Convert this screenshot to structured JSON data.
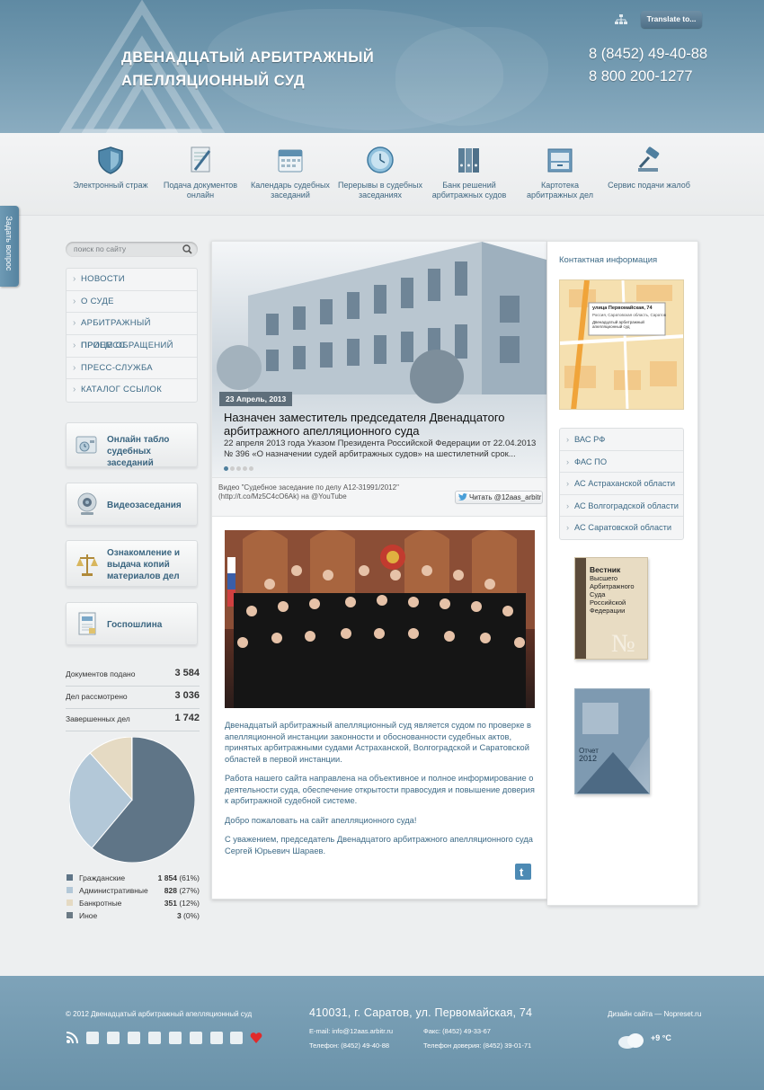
{
  "header": {
    "title_line1": "ДВЕНАДЦАТЫЙ АРБИТРАЖНЫЙ",
    "title_line2": "АПЕЛЛЯЦИОННЫЙ СУД",
    "phone1": "8 (8452) 49-40-88",
    "phone2": "8 800 200-1277",
    "translate_label": "Translate to...",
    "sitemap_icon": "sitemap-icon"
  },
  "quick_icons": [
    {
      "label": "Электронный страж",
      "icon": "shield-icon"
    },
    {
      "label": "Подача документов онлайн",
      "icon": "document-pen-icon"
    },
    {
      "label": "Календарь судебных заседаний",
      "icon": "calendar-icon"
    },
    {
      "label": "Перерывы в судебных заседаниях",
      "icon": "clock-icon"
    },
    {
      "label": "Банк решений арбитражных судов",
      "icon": "binders-icon"
    },
    {
      "label": "Картотека арбитражных дел",
      "icon": "card-index-icon"
    },
    {
      "label": "Сервис подачи жалоб",
      "icon": "gavel-icon"
    }
  ],
  "ask_question": "Задать вопрос",
  "search": {
    "placeholder": "поиск по сайту"
  },
  "menu": [
    "НОВОСТИ",
    "О СУДЕ",
    "АРБИТРАЖНЫЙ ПРОЦЕСС",
    "ПРИЕМ ОБРАЩЕНИЙ",
    "ПРЕСС-СЛУЖБА",
    "КАТАЛОГ ССЫЛОК"
  ],
  "side_buttons": [
    {
      "line1": "Онлайн табло",
      "line2": "судебных заседаний",
      "line3": "",
      "icon": "board-icon"
    },
    {
      "line1": "Видеозаседания",
      "line2": "",
      "line3": "",
      "icon": "webcam-icon"
    },
    {
      "line1": "Ознакомление и",
      "line2": "выдача копий",
      "line3": "материалов дел",
      "icon": "scales-icon"
    },
    {
      "line1": "Госпошлина",
      "line2": "",
      "line3": "",
      "icon": "receipt-icon"
    }
  ],
  "stats": [
    {
      "label": "Документов подано",
      "value": "3 584"
    },
    {
      "label": "Дел рассмотрено",
      "value": "3 036"
    },
    {
      "label": "Завершенных дел",
      "value": "1 742"
    }
  ],
  "chart_data": {
    "type": "pie",
    "categories": [
      "Гражданские",
      "Административные",
      "Банкротные",
      "Иное"
    ],
    "values": [
      1854,
      828,
      351,
      3
    ],
    "percent_labels": [
      "(61%)",
      "(27%)",
      "(12%)",
      "(0%)"
    ],
    "value_labels": [
      "1 854",
      "828",
      "351",
      "3"
    ],
    "colors": [
      "#5f7587",
      "#b3c8d8",
      "#e5dac3",
      "#6b7a85"
    ]
  },
  "slider": {
    "date": "23 Апрель, 2013",
    "headline": "Назначен заместитель председателя Двенадцатого арбитражного апелляционного суда",
    "text": "22 апреля 2013 года Указом Президента Российской Федерации от 22.04.2013 № 396 «О назначении судей арбитражных судов» на шестилетний срок..."
  },
  "tweet": {
    "text": "Видео \"Судебное заседание по делу А12-31991/2012\" (http://t.co/Mz5C4cO6Ak) на @YouTube",
    "button": "Читать @12aas_arbitr"
  },
  "intro": {
    "p1": "Двенадцатый арбитражный апелляционный суд является судом по проверке в апелляционной инстанции законности и обоснованности судебных актов, принятых арбитражными судами Астраханской, Волгоградской и Саратовской областей в первой инстанции.",
    "p2": "Работа нашего сайта направлена на объективное и полное информирование о деятельности суда, обеспечение открытости правосудия и повышение доверия к арбитражной судебной системе.",
    "p3": "Добро пожаловать на сайт апелляционного суда!",
    "p4": "С уважением, председатель Двенадцатого арбитражного апелляционного суда Сергей Юрьевич Шараев."
  },
  "right": {
    "contact_title": "Контактная информация",
    "map_street": "улица Первомайская, 74",
    "map_addr": "Россия, Саратовская область, Саратов",
    "map_org": "Двенадцатый арбитражный апелляционный суд",
    "links": [
      "ВАС РФ",
      "ФАС ПО",
      "АС Астраханской области",
      "АС Волгоградской области",
      "АС Саратовской области"
    ],
    "book1_title": "Вестник",
    "book1_sub": "Высшего Арбитражного Суда Российской Федерации",
    "book1_no": "№",
    "book2_title": "Отчет",
    "book2_year": "2012"
  },
  "footer": {
    "copyright": "© 2012 Двенадцатый арбитражный апелляционный суд",
    "address": "410031, г. Саратов, ул. Первомайская, 74",
    "email": "E-mail: info@12aas.arbitr.ru",
    "fax": "Факс: (8452) 49-33-67",
    "phone": "Телефон: (8452) 49-40-88",
    "trust": "Телефон доверия: (8452) 39-01-71",
    "design": "Дизайн сайта — Nopreset.ru",
    "weather": "+9 °C"
  }
}
